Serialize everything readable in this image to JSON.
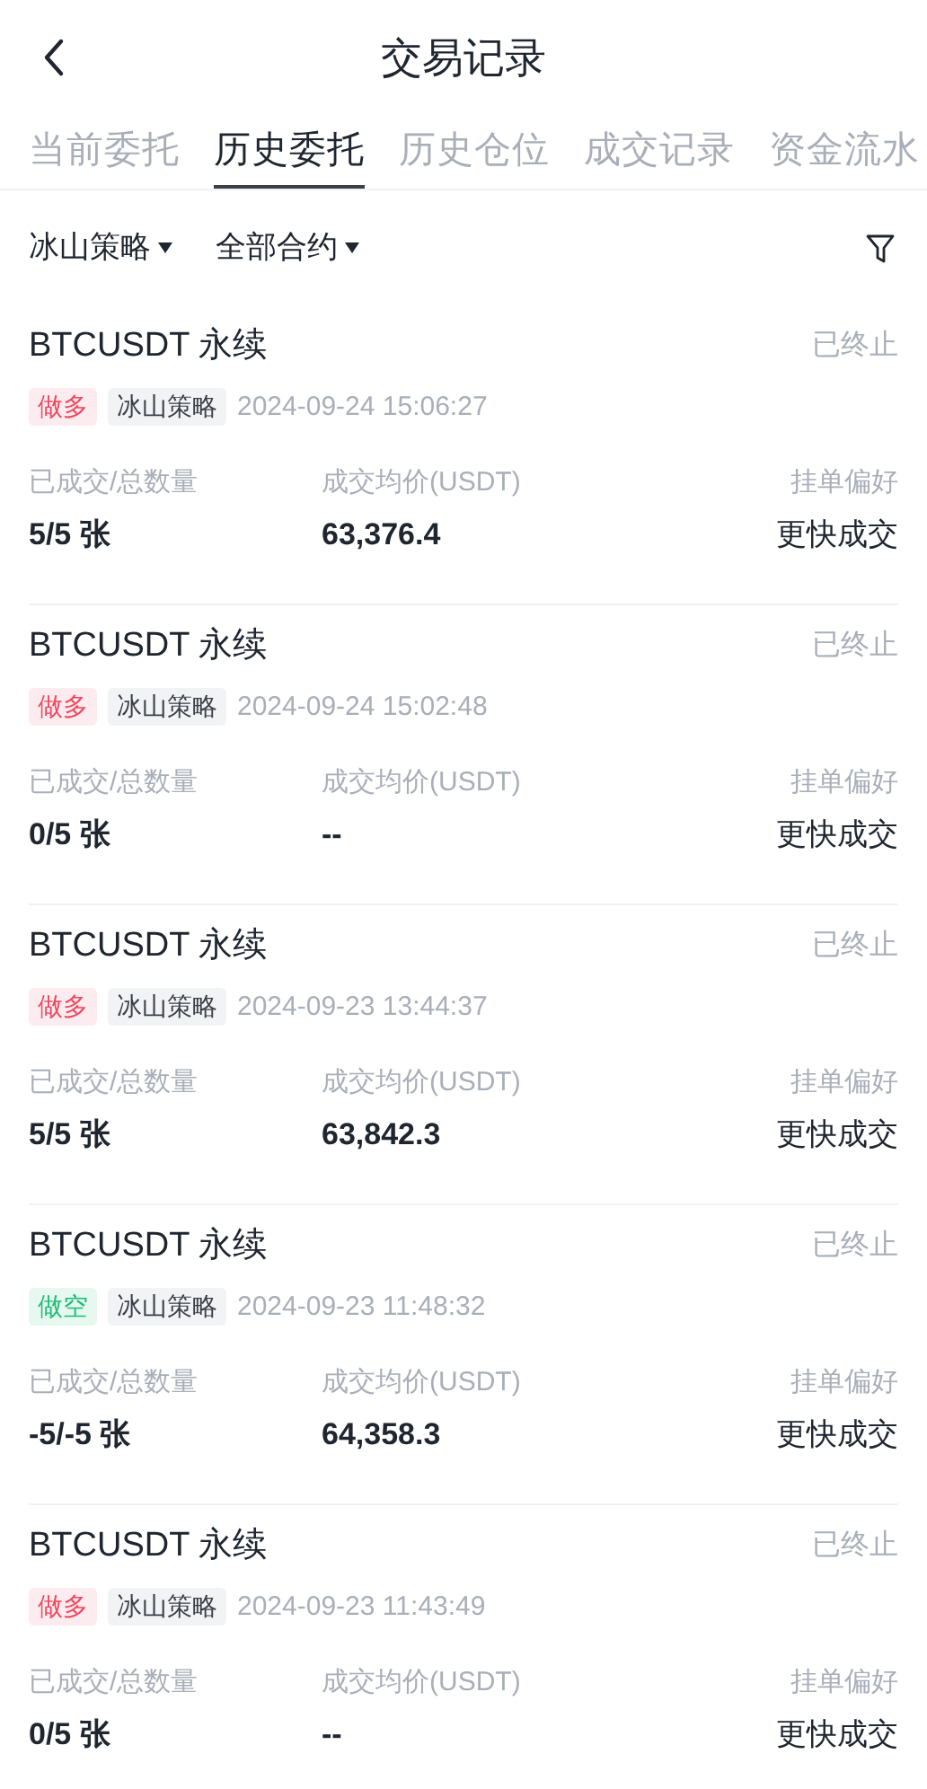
{
  "header": {
    "title": "交易记录"
  },
  "tabs": [
    {
      "label": "当前委托",
      "selected": false
    },
    {
      "label": "历史委托",
      "selected": true
    },
    {
      "label": "历史仓位",
      "selected": false
    },
    {
      "label": "成交记录",
      "selected": false
    },
    {
      "label": "资金流水",
      "selected": false
    }
  ],
  "filters": [
    {
      "label": "冰山策略"
    },
    {
      "label": "全部合约"
    }
  ],
  "orders": [
    {
      "symbol": "BTCUSDT 永续",
      "status": "已终止",
      "side": {
        "kind": "long",
        "label": "做多"
      },
      "strategy": "冰山策略",
      "time": "2024-09-24 15:06:27",
      "filled_label": "已成交/总数量",
      "filled": "5/5 张",
      "price_label": "成交均价(USDT)",
      "price": "63,376.4",
      "pref_label": "挂单偏好",
      "pref": "更快成交"
    },
    {
      "symbol": "BTCUSDT 永续",
      "status": "已终止",
      "side": {
        "kind": "long",
        "label": "做多"
      },
      "strategy": "冰山策略",
      "time": "2024-09-24 15:02:48",
      "filled_label": "已成交/总数量",
      "filled": "0/5 张",
      "price_label": "成交均价(USDT)",
      "price": "--",
      "pref_label": "挂单偏好",
      "pref": "更快成交"
    },
    {
      "symbol": "BTCUSDT 永续",
      "status": "已终止",
      "side": {
        "kind": "long",
        "label": "做多"
      },
      "strategy": "冰山策略",
      "time": "2024-09-23 13:44:37",
      "filled_label": "已成交/总数量",
      "filled": "5/5 张",
      "price_label": "成交均价(USDT)",
      "price": "63,842.3",
      "pref_label": "挂单偏好",
      "pref": "更快成交"
    },
    {
      "symbol": "BTCUSDT 永续",
      "status": "已终止",
      "side": {
        "kind": "short",
        "label": "做空"
      },
      "strategy": "冰山策略",
      "time": "2024-09-23 11:48:32",
      "filled_label": "已成交/总数量",
      "filled": "-5/-5 张",
      "price_label": "成交均价(USDT)",
      "price": "64,358.3",
      "pref_label": "挂单偏好",
      "pref": "更快成交"
    },
    {
      "symbol": "BTCUSDT 永续",
      "status": "已终止",
      "side": {
        "kind": "long",
        "label": "做多"
      },
      "strategy": "冰山策略",
      "time": "2024-09-23 11:43:49",
      "filled_label": "已成交/总数量",
      "filled": "0/5 张",
      "price_label": "成交均价(USDT)",
      "price": "--",
      "pref_label": "挂单偏好",
      "pref": "更快成交"
    }
  ]
}
